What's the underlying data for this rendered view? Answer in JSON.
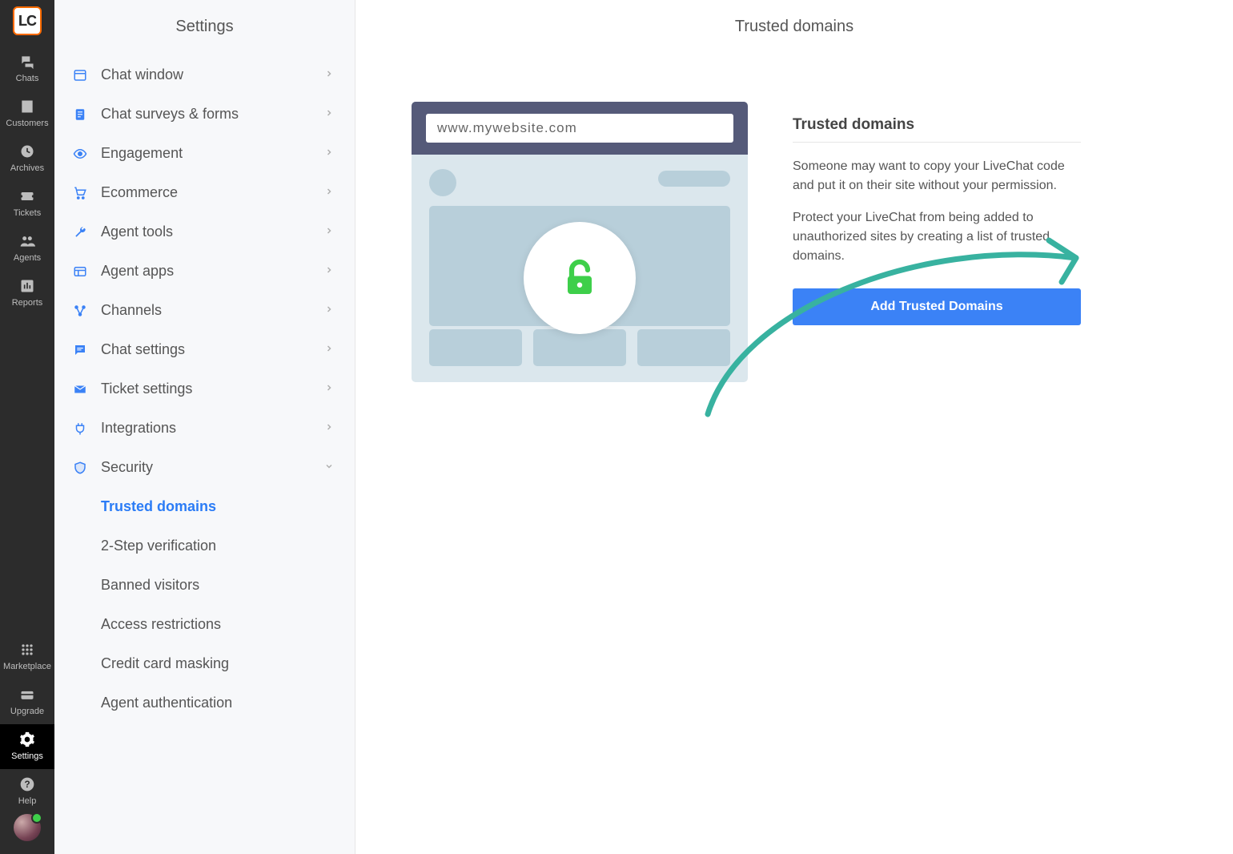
{
  "rail": {
    "logo": "LC",
    "top_items": [
      {
        "id": "chats",
        "label": "Chats"
      },
      {
        "id": "customers",
        "label": "Customers"
      },
      {
        "id": "archives",
        "label": "Archives"
      },
      {
        "id": "tickets",
        "label": "Tickets"
      },
      {
        "id": "agents",
        "label": "Agents"
      },
      {
        "id": "reports",
        "label": "Reports"
      }
    ],
    "bottom_items": [
      {
        "id": "marketplace",
        "label": "Marketplace"
      },
      {
        "id": "upgrade",
        "label": "Upgrade"
      },
      {
        "id": "settings",
        "label": "Settings",
        "active": true
      },
      {
        "id": "help",
        "label": "Help"
      }
    ]
  },
  "sidebar": {
    "title": "Settings",
    "groups": [
      {
        "id": "chat-window",
        "label": "Chat window"
      },
      {
        "id": "surveys-forms",
        "label": "Chat surveys & forms"
      },
      {
        "id": "engagement",
        "label": "Engagement"
      },
      {
        "id": "ecommerce",
        "label": "Ecommerce"
      },
      {
        "id": "agent-tools",
        "label": "Agent tools"
      },
      {
        "id": "agent-apps",
        "label": "Agent apps"
      },
      {
        "id": "channels",
        "label": "Channels"
      },
      {
        "id": "chat-settings",
        "label": "Chat settings"
      },
      {
        "id": "ticket-settings",
        "label": "Ticket settings"
      },
      {
        "id": "integrations",
        "label": "Integrations"
      },
      {
        "id": "security",
        "label": "Security",
        "expanded": true,
        "children": [
          {
            "id": "trusted-domains",
            "label": "Trusted domains",
            "active": true
          },
          {
            "id": "two-step",
            "label": "2-Step verification"
          },
          {
            "id": "banned-visitors",
            "label": "Banned visitors"
          },
          {
            "id": "access-restrictions",
            "label": "Access restrictions"
          },
          {
            "id": "credit-card-masking",
            "label": "Credit card masking"
          },
          {
            "id": "agent-authentication",
            "label": "Agent authentication"
          }
        ]
      }
    ]
  },
  "main": {
    "title": "Trusted domains",
    "illustration_url": "www.mywebsite.com",
    "panel": {
      "heading": "Trusted domains",
      "para1": "Someone may want to copy your LiveChat code and put it on their site without your permission.",
      "para2": "Protect your LiveChat from being added to unauthorized sites by creating a list of trusted domains.",
      "button_label": "Add Trusted Domains"
    }
  },
  "colors": {
    "accent": "#3b82f6",
    "green": "#3ecf4a",
    "teal": "#38b2a0"
  }
}
